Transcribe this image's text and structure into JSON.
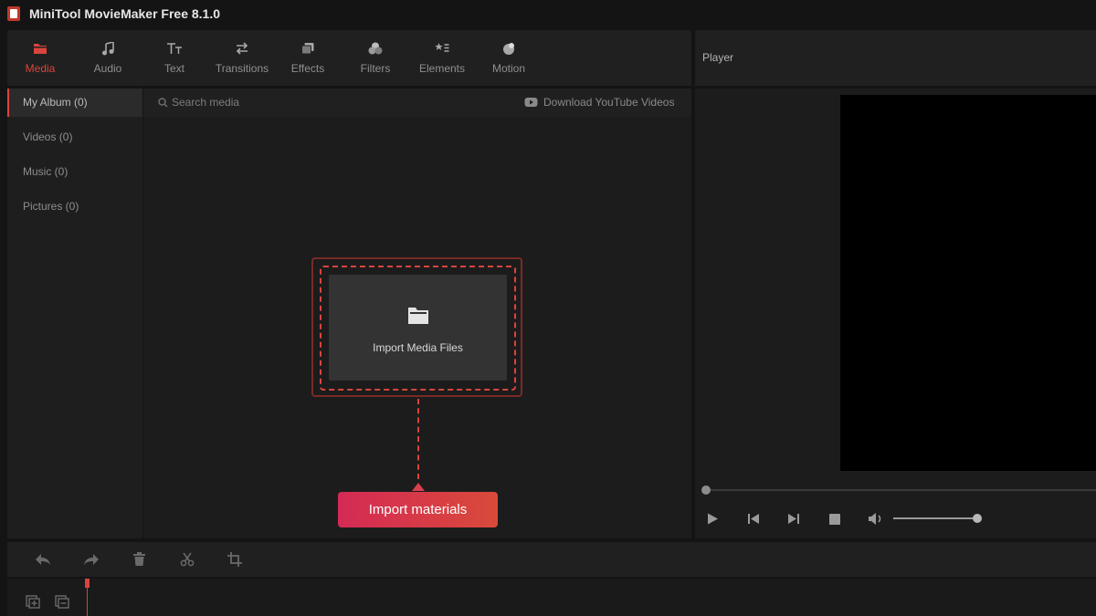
{
  "app": {
    "title": "MiniTool MovieMaker Free 8.1.0"
  },
  "toolbar": {
    "tabs": [
      {
        "label": "Media",
        "icon": "folder-icon",
        "active": true
      },
      {
        "label": "Audio",
        "icon": "music-note-icon"
      },
      {
        "label": "Text",
        "icon": "text-tt-icon"
      },
      {
        "label": "Transitions",
        "icon": "swap-arrows-icon"
      },
      {
        "label": "Effects",
        "icon": "layers-icon"
      },
      {
        "label": "Filters",
        "icon": "circles-icon"
      },
      {
        "label": "Elements",
        "icon": "star-list-icon"
      },
      {
        "label": "Motion",
        "icon": "motion-ball-icon"
      }
    ],
    "accent_color": "#d9443c"
  },
  "sidebar": {
    "items": [
      {
        "label": "My Album (0)",
        "active": true
      },
      {
        "label": "Videos (0)"
      },
      {
        "label": "Music (0)"
      },
      {
        "label": "Pictures (0)"
      }
    ]
  },
  "media": {
    "search_placeholder": "Search media",
    "download_label": "Download YouTube Videos",
    "import_label": "Import Media Files",
    "tip_label": "Import materials"
  },
  "player": {
    "label": "Player"
  }
}
